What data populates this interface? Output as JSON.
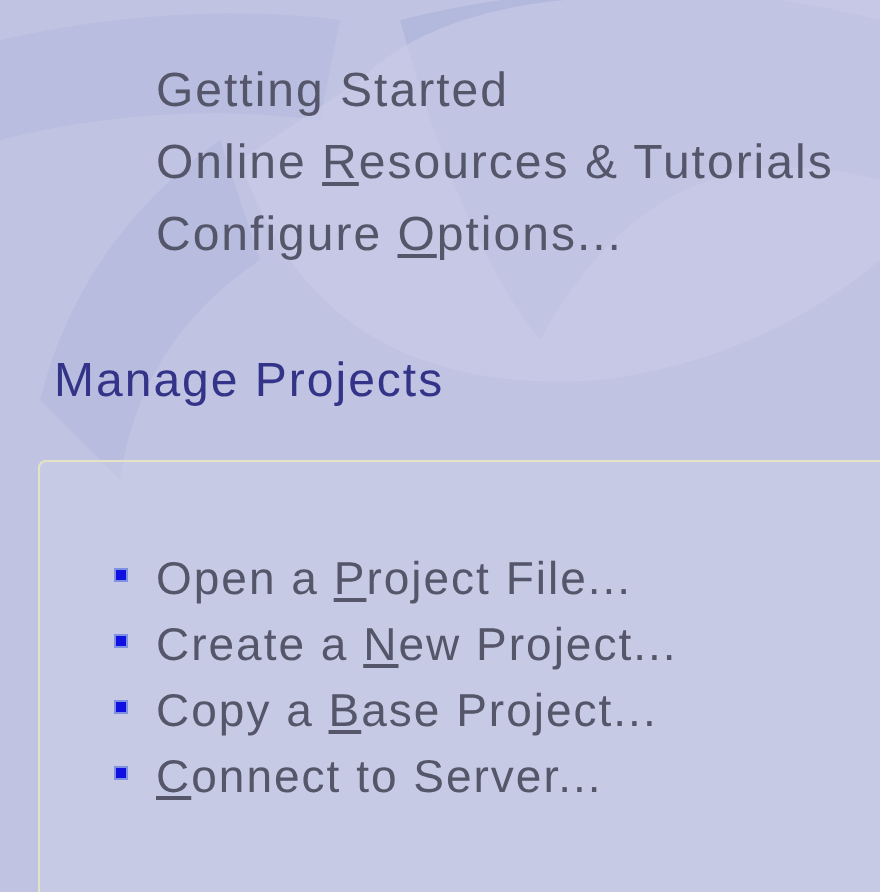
{
  "links": [
    {
      "text_before": "Getting Started"
    },
    {
      "text_before": "Online ",
      "access_key": "R",
      "text_after": "esources & Tutorials"
    },
    {
      "text_before": "Configure ",
      "access_key": "O",
      "text_after": "ptions..."
    }
  ],
  "manage_projects": {
    "title": "Manage Projects",
    "actions": [
      {
        "text_before": "Open a ",
        "access_key": "P",
        "text_after": "roject File..."
      },
      {
        "text_before": "Create a ",
        "access_key": "N",
        "text_after": "ew Project..."
      },
      {
        "text_before": "Copy a ",
        "access_key": "B",
        "text_after": "ase Project..."
      },
      {
        "access_key": "C",
        "text_after": "onnect to Server..."
      }
    ]
  }
}
